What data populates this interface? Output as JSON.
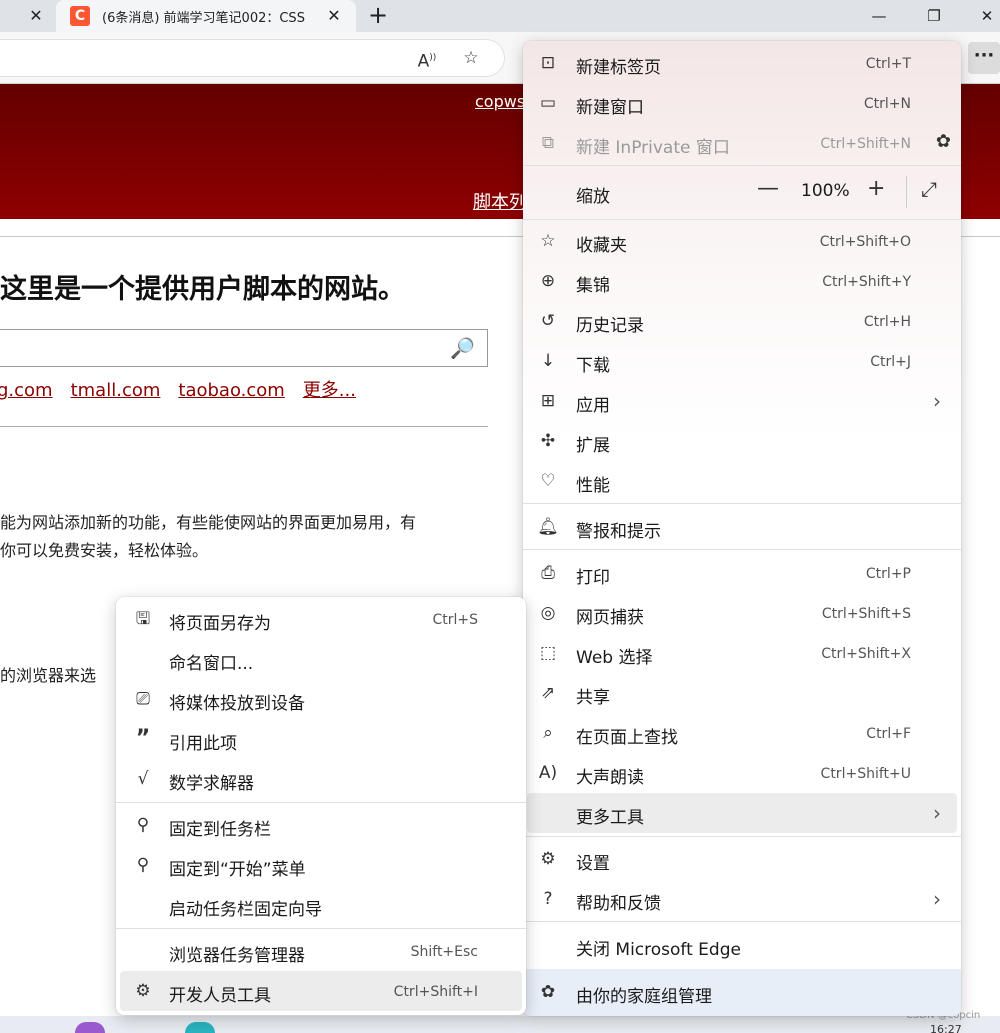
{
  "tabs": {
    "active_title": "(6条消息) 前端学习笔记002：CSS",
    "favicon_letter": "C",
    "close_glyph": "✕",
    "new_tab_glyph": "+"
  },
  "window": {
    "minimize": "—",
    "restore": "❐",
    "close": "✕"
  },
  "toolbar": {
    "more_glyph": "···"
  },
  "page": {
    "banner_link_top": "copws",
    "banner_link_bottom": "脚本列",
    "headline": "这里是一个提供用户脚本的网站。",
    "links": [
      "g.com",
      "tmall.com",
      "taobao.com",
      "更多..."
    ],
    "para1": "能为网站添加新的功能，有些能使网站的界面更加易用，有",
    "para2": "你可以免费安装，轻松体验。",
    "para3": "的浏览器来选"
  },
  "main_menu": {
    "new_tab": {
      "label": "新建标签页",
      "shortcut": "Ctrl+T"
    },
    "new_window": {
      "label": "新建窗口",
      "shortcut": "Ctrl+N"
    },
    "new_inprivate": {
      "label": "新建 InPrivate 窗口",
      "shortcut": "Ctrl+Shift+N"
    },
    "zoom": {
      "label": "缩放",
      "minus": "—",
      "value": "100%",
      "plus": "+",
      "fullscreen": "⤢"
    },
    "favorites": {
      "label": "收藏夹",
      "shortcut": "Ctrl+Shift+O"
    },
    "collections": {
      "label": "集锦",
      "shortcut": "Ctrl+Shift+Y"
    },
    "history": {
      "label": "历史记录",
      "shortcut": "Ctrl+H"
    },
    "downloads": {
      "label": "下载",
      "shortcut": "Ctrl+J"
    },
    "apps": {
      "label": "应用"
    },
    "extensions": {
      "label": "扩展"
    },
    "performance": {
      "label": "性能"
    },
    "alerts": {
      "label": "警报和提示"
    },
    "print": {
      "label": "打印",
      "shortcut": "Ctrl+P"
    },
    "web_capture": {
      "label": "网页捕获",
      "shortcut": "Ctrl+Shift+S"
    },
    "web_select": {
      "label": "Web 选择",
      "shortcut": "Ctrl+Shift+X"
    },
    "share": {
      "label": "共享"
    },
    "find": {
      "label": "在页面上查找",
      "shortcut": "Ctrl+F"
    },
    "read_aloud": {
      "label": "大声朗读",
      "shortcut": "Ctrl+Shift+U"
    },
    "more_tools": {
      "label": "更多工具"
    },
    "settings": {
      "label": "设置"
    },
    "help": {
      "label": "帮助和反馈"
    },
    "close_edge": {
      "label": "关闭 Microsoft Edge"
    },
    "family": {
      "label": "由你的家庭组管理"
    }
  },
  "sub_menu": {
    "save_as": {
      "label": "将页面另存为",
      "shortcut": "Ctrl+S"
    },
    "name_window": {
      "label": "命名窗口..."
    },
    "cast": {
      "label": "将媒体投放到设备"
    },
    "cite": {
      "label": "引用此项"
    },
    "math": {
      "label": "数学求解器"
    },
    "pin_taskbar": {
      "label": "固定到任务栏"
    },
    "pin_start": {
      "label": "固定到“开始”菜单"
    },
    "pin_wizard": {
      "label": "启动任务栏固定向导"
    },
    "task_manager": {
      "label": "浏览器任务管理器",
      "shortcut": "Shift+Esc"
    },
    "devtools": {
      "label": "开发人员工具",
      "shortcut": "Ctrl+Shift+I"
    }
  },
  "footer": {
    "watermark": "CSDN @copcin",
    "clock": "16:27"
  },
  "colors": {
    "banner": "#8f0000",
    "favicon": "#fc5531",
    "link": "#8b0000"
  }
}
